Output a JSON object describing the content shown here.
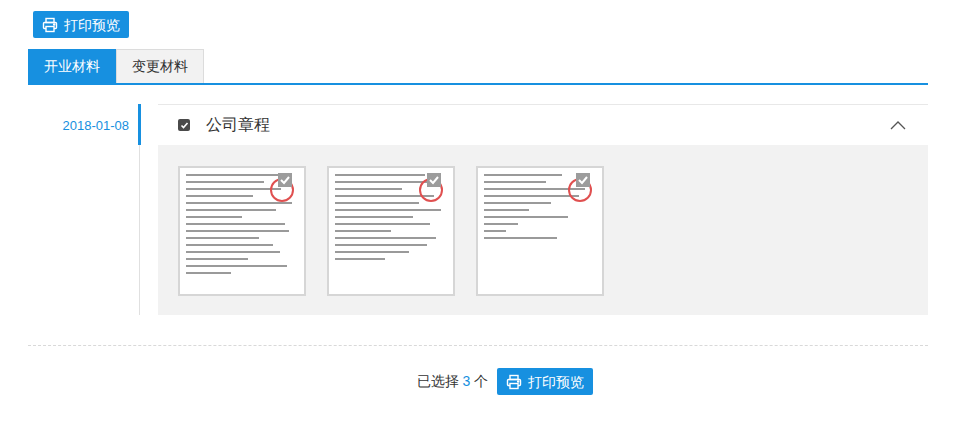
{
  "toolbar": {
    "button": "打印预览"
  },
  "tabs": [
    {
      "label": "开业材料",
      "selected": true
    },
    {
      "label": "变更材料",
      "selected": false
    }
  ],
  "timeline": [
    {
      "date": "2018-01-08",
      "groups": [
        {
          "title": "公司章程",
          "checked": true,
          "expanded": true,
          "thumbnails": [
            {
              "selected": true
            },
            {
              "selected": true
            },
            {
              "selected": true
            }
          ]
        }
      ]
    }
  ],
  "footer": {
    "prefix": "已选择",
    "count": "3",
    "suffix": "个",
    "button": "打印预览"
  }
}
